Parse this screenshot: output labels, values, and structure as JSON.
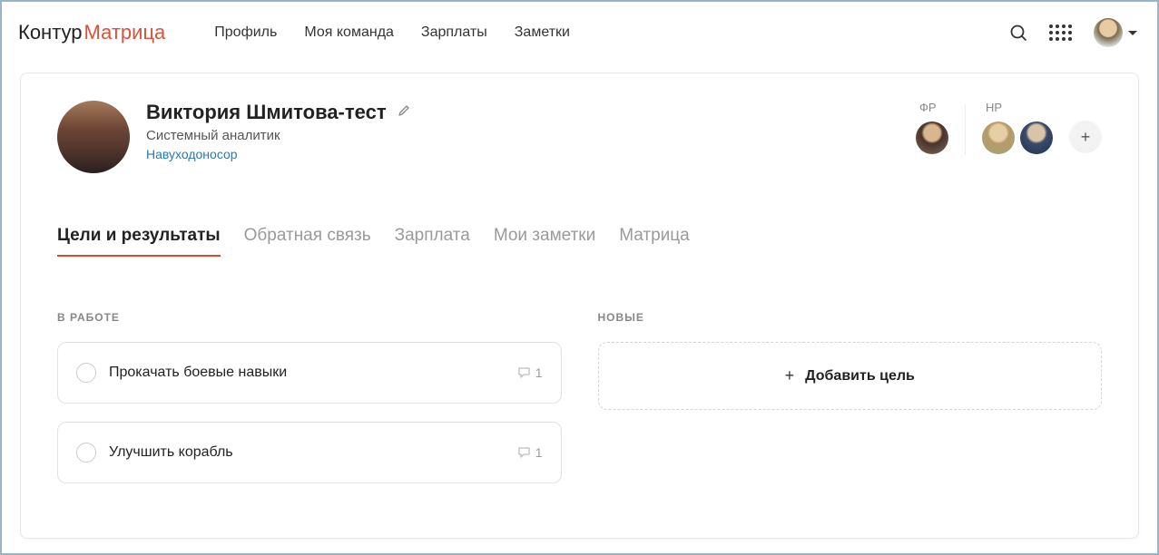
{
  "logo": {
    "part1": "Контур",
    "part2": "Матрица"
  },
  "nav": {
    "profile": "Профиль",
    "team": "Моя команда",
    "salaries": "Зарплаты",
    "notes": "Заметки"
  },
  "profile": {
    "name": "Виктория Шмитова-тест",
    "role": "Системный аналитик",
    "team": "Навуходоносор"
  },
  "roles": {
    "fr_label": "ФР",
    "hr_label": "HP"
  },
  "tabs": {
    "goals": "Цели и результаты",
    "feedback": "Обратная связь",
    "salary": "Зарплата",
    "mynotes": "Мои заметки",
    "matrix": "Матрица"
  },
  "columns": {
    "inprogress": "В РАБОТЕ",
    "new": "НОВЫЕ"
  },
  "goals": [
    {
      "title": "Прокачать боевые навыки",
      "comments": "1"
    },
    {
      "title": "Улучшить корабль",
      "comments": "1"
    }
  ],
  "add_goal": "Добавить цель"
}
